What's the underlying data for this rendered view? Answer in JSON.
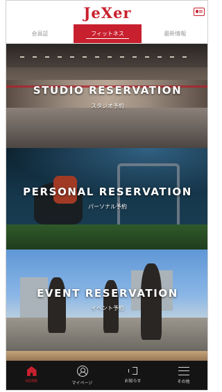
{
  "app": {
    "logo_text": "JeXer"
  },
  "tabs": [
    {
      "label": "会員証",
      "active": false
    },
    {
      "label": "フィットネス",
      "active": true
    },
    {
      "label": "最新情報",
      "active": false
    }
  ],
  "banners": [
    {
      "title": "STUDIO RESERVATION",
      "subtitle": "スタジオ予約"
    },
    {
      "title": "PERSONAL RESERVATION",
      "subtitle": "パーソナル予約"
    },
    {
      "title": "EVENT RESERVATION",
      "subtitle": "イベント予約"
    }
  ],
  "bottom_nav": [
    {
      "label": "HOME",
      "icon": "home-icon",
      "active": true
    },
    {
      "label": "マイページ",
      "icon": "user-icon",
      "active": false
    },
    {
      "label": "お知らせ",
      "icon": "megaphone-icon",
      "active": false
    },
    {
      "label": "その他",
      "icon": "menu-icon",
      "active": false
    }
  ],
  "colors": {
    "accent": "#c8202e",
    "nav_bg": "#141414"
  }
}
